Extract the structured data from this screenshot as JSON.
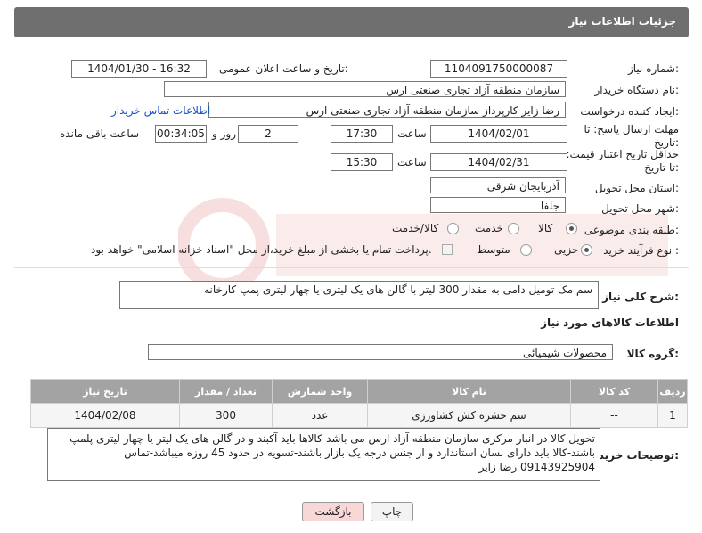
{
  "header": {
    "title": "جزئیات اطلاعات نیاز"
  },
  "fields": {
    "need_number_label": "شماره نیاز:",
    "need_number": "1104091750000087",
    "announce_label": "تاریخ و ساعت اعلان عمومی:",
    "announce_value": "1404/01/30 - 16:32",
    "buyer_org_label": "نام دستگاه خریدار:",
    "buyer_org": "سازمان منطقه آزاد تجاری صنعتی ارس",
    "creator_label": "ایجاد کننده درخواست:",
    "creator": "رضا زایر کارپرداز سازمان منطقه آزاد تجاری صنعتی ارس",
    "buyer_contact_link": "اطلاعات تماس خریدار",
    "reply_deadline_label": "مهلت ارسال پاسخ: تا تاریخ:",
    "reply_date": "1404/02/01",
    "time_label": "ساعت",
    "reply_time": "17:30",
    "days_value": "2",
    "days_label": "روز و",
    "remaining_time": "00:34:05",
    "remaining_label": "ساعت باقی مانده",
    "price_validity_label": "حداقل تاریخ اعتبار قیمت: تا تاریخ:",
    "price_date": "1404/02/31",
    "price_time": "15:30",
    "province_label": "استان محل تحویل:",
    "province": "آذربایجان شرقی",
    "city_label": "شهر محل تحویل:",
    "city": "جلفا",
    "category_label": "طبقه بندی موضوعی:",
    "category_options": [
      "کالا",
      "خدمت",
      "کالا/خدمت"
    ],
    "purchase_type_label": "نوع فرآیند خرید :",
    "purchase_options": [
      "جزیی",
      "متوسط"
    ],
    "payment_note": "پرداخت تمام یا بخشی از مبلغ خرید،از محل \"اسناد خزانه اسلامی\" خواهد بود."
  },
  "description": {
    "label": "شرح کلی نیاز:",
    "text": "سم مک تومیل دامی به مقدار 300 لیتر با گالن های یک لیتری یا چهار لیتری پمپ کارخانه"
  },
  "goods": {
    "section_title": "اطلاعات کالاهای مورد نیاز",
    "group_label": "گروه کالا:",
    "group_value": "محصولات شیمیائی",
    "columns": [
      "ردیف",
      "کد کالا",
      "نام کالا",
      "واحد شمارش",
      "تعداد / مقدار",
      "تاریخ نیاز"
    ],
    "rows": [
      {
        "row": "1",
        "code": "--",
        "name": "سم حشره کش کشاورزی",
        "unit": "عدد",
        "qty": "300",
        "date": "1404/02/08"
      }
    ]
  },
  "buyer_notes": {
    "label": "توضیحات خریدار:",
    "text": "تحویل کالا در انبار مرکزی سازمان منطقه آزاد ارس می باشد-کالاها باید آکبند و در گالن های یک لیتر یا چهار لیتری پلمپ باشند-کالا باید دارای نسان استاندارد و از جنس درجه یک بازار باشند-تسویه در حدود 45 روزه میباشد-تماس 09143925904 رضا زایر"
  },
  "buttons": {
    "print": "چاپ",
    "back": "بازگشت"
  },
  "colors": {
    "header_bg": "#6f6f6f",
    "table_header_bg": "#a3a3a3",
    "link": "#1a55c4",
    "back_btn_bg": "#f8d7d7"
  }
}
